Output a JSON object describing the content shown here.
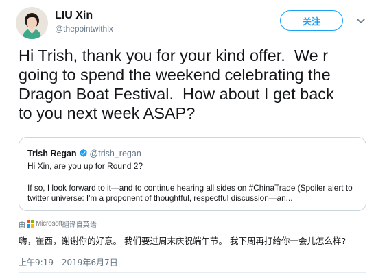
{
  "author": {
    "name": "LIU Xin",
    "handle": "@thepointwithlx",
    "follow_label": "关注"
  },
  "tweet": {
    "text": "Hi Trish, thank you for your kind offer.  We r\ngoing to spend the weekend celebrating the\nDragon Boat Festival.  How about I get back\nto you next week ASAP?"
  },
  "quoted": {
    "name": "Trish Regan",
    "handle": "@trish_regan",
    "line1": "Hi Xin, are you up for Round 2?",
    "body": "If so, I look forward to it—and to continue hearing all sides on #ChinaTrade (Spoiler alert to twitter universe: I'm a proponent of thoughtful, respectful discussion—an..."
  },
  "translation": {
    "prefix": "由",
    "provider": "Microsoft",
    "suffix": "翻译自英语",
    "text": "嗨，崔西，谢谢你的好意。 我们要过周末庆祝端午节。 我下周再打给你一会儿怎么样?"
  },
  "timestamp": "上午9:19 - 2019年6月7日",
  "colors": {
    "accent": "#1da1f2",
    "verified": "#1da1f2",
    "ms_red": "#f25022",
    "ms_green": "#7fba00",
    "ms_blue": "#00a4ef",
    "ms_yellow": "#ffb900"
  }
}
